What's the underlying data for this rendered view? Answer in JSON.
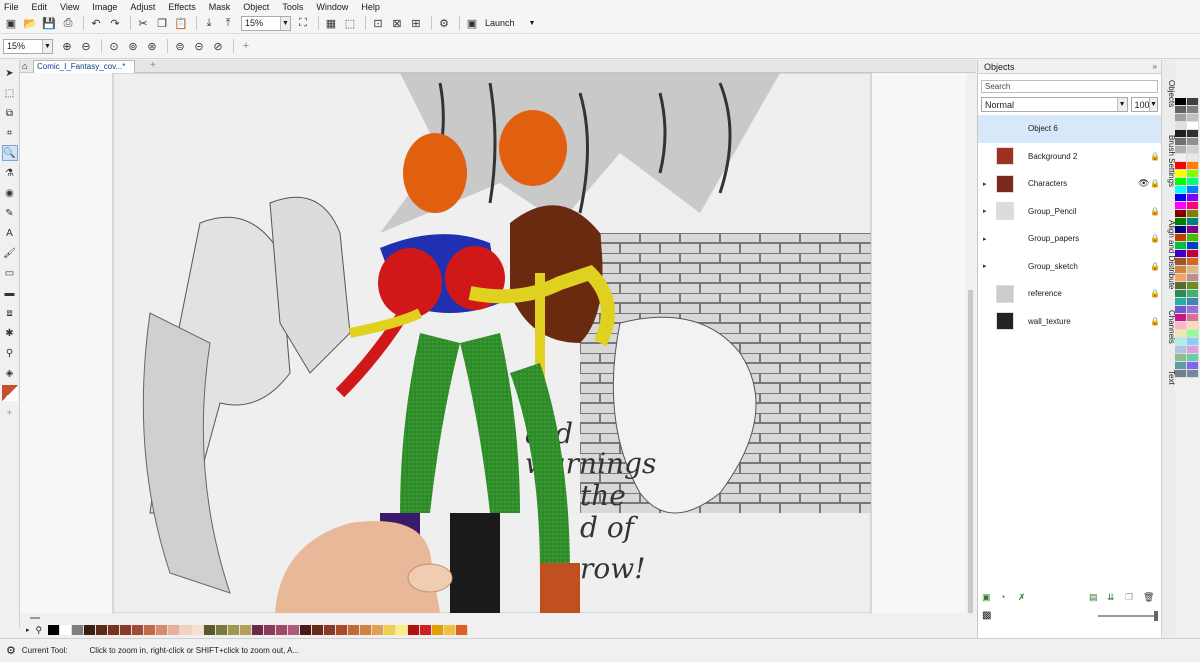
{
  "menu": [
    "File",
    "Edit",
    "View",
    "Image",
    "Adjust",
    "Effects",
    "Mask",
    "Object",
    "Tools",
    "Window",
    "Help"
  ],
  "toolbar": {
    "zoom_value": "15%",
    "launch_label": "Launch"
  },
  "propbar": {
    "zoom_value": "15%"
  },
  "document_tab": {
    "title": "Comic_I_Fantasy_cov...*"
  },
  "objects_panel": {
    "title": "Objects",
    "search_placeholder": "Search",
    "blend_mode": "Normal",
    "opacity": "100",
    "layers": [
      {
        "name": "Object 6",
        "selected": true,
        "expandable": false,
        "visible_icon": false,
        "locked": false
      },
      {
        "name": "Background 2",
        "selected": false,
        "expandable": false,
        "visible_icon": false,
        "locked": true
      },
      {
        "name": "Characters",
        "selected": false,
        "expandable": true,
        "visible_icon": true,
        "locked": true
      },
      {
        "name": "Group_Pencil",
        "selected": false,
        "expandable": true,
        "visible_icon": false,
        "locked": true
      },
      {
        "name": "Group_papers",
        "selected": false,
        "expandable": true,
        "visible_icon": false,
        "locked": true
      },
      {
        "name": "Group_sketch",
        "selected": false,
        "expandable": true,
        "visible_icon": false,
        "locked": true
      },
      {
        "name": "reference",
        "selected": false,
        "expandable": false,
        "visible_icon": false,
        "locked": true
      },
      {
        "name": "wall_texture",
        "selected": false,
        "expandable": false,
        "visible_icon": false,
        "locked": true
      }
    ]
  },
  "side_tabs": [
    "Objects",
    "Brush Settings",
    "Align and Distribute",
    "Channels",
    "Text"
  ],
  "status": {
    "label": "Current Tool:",
    "message": "Click to zoom in, right-click or SHIFT+click to zoom out, A..."
  },
  "canvas_text": {
    "line1": "ard",
    "line2": "warnings",
    "line3": "the",
    "line4": "d of",
    "line5": "row!"
  },
  "colors": {
    "bottom_swatches": [
      "#000000",
      "#ffffff",
      "#7f7f7f",
      "#3b1d12",
      "#5c2a1a",
      "#7a3320",
      "#8c3a2a",
      "#a04a3a",
      "#c06a4a",
      "#d88a6a",
      "#e8b09a",
      "#f4d0c0",
      "#f8e0d0",
      "#5a5a2a",
      "#7a7a3a",
      "#9a9a4a",
      "#b0a05a",
      "#6a2a4a",
      "#8a3a5a",
      "#a04a6a",
      "#b05a7a",
      "#4a1a1a",
      "#6a2a1a",
      "#8a3a2a",
      "#aa4a2a",
      "#c06a3a",
      "#d08040",
      "#e0a050",
      "#f0d050",
      "#f8f080",
      "#b01010",
      "#d02020",
      "#e0a000",
      "#f0c040",
      "#e06020"
    ],
    "palette": [
      "#000000",
      "#404040",
      "#606060",
      "#808080",
      "#a0a0a0",
      "#c0c0c0",
      "#e0e0e0",
      "#ffffff",
      "#202020",
      "#303030",
      "#707070",
      "#909090",
      "#b0b0b0",
      "#d0d0d0",
      "#f0f0f0",
      "#e8e8e8",
      "#ff0000",
      "#ff8000",
      "#ffff00",
      "#80ff00",
      "#00ff00",
      "#00ff80",
      "#00ffff",
      "#0080ff",
      "#0000ff",
      "#8000ff",
      "#ff00ff",
      "#ff0080",
      "#800000",
      "#808000",
      "#008000",
      "#008080",
      "#000080",
      "#800080",
      "#c04000",
      "#40c000",
      "#00c040",
      "#0040c0",
      "#4000c0",
      "#c00040",
      "#a0522d",
      "#d2691e",
      "#cd853f",
      "#deb887",
      "#f4a460",
      "#bc8f8f",
      "#556b2f",
      "#6b8e23",
      "#2e8b57",
      "#3cb371",
      "#20b2aa",
      "#4682b4",
      "#6a5acd",
      "#9370db",
      "#c71585",
      "#db7093",
      "#ffb6c1",
      "#ffdab9",
      "#eee8aa",
      "#98fb98",
      "#afeeee",
      "#87cefa",
      "#b0c4de",
      "#dda0dd",
      "#8fbc8f",
      "#66cdaa",
      "#5f9ea0",
      "#7b68ee",
      "#708090",
      "#778899"
    ],
    "selection_blue": "#d6e8f9"
  }
}
